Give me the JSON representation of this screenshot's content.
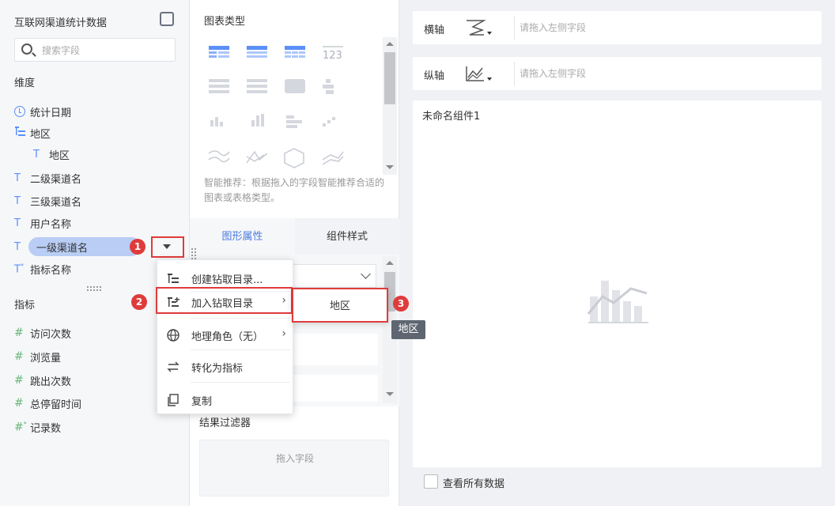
{
  "left": {
    "title": "互联网渠道统计数据",
    "search_placeholder": "搜索字段",
    "dimension_header": "维度",
    "dimensions": [
      {
        "label": "统计日期",
        "icon": "clock-icon"
      },
      {
        "label": "地区",
        "icon": "hierarchy-icon"
      },
      {
        "label": "地区",
        "icon": "text-type-icon",
        "indent": true
      },
      {
        "label": "二级渠道名",
        "icon": "text-type-icon"
      },
      {
        "label": "三级渠道名",
        "icon": "text-type-icon"
      },
      {
        "label": "用户名称",
        "icon": "text-type-icon"
      },
      {
        "label": "一级渠道名",
        "icon": "text-type-icon",
        "selected": true
      },
      {
        "label": "指标名称",
        "icon": "text-type-icon"
      }
    ],
    "measure_header": "指标",
    "measures": [
      {
        "label": "访问次数"
      },
      {
        "label": "浏览量"
      },
      {
        "label": "跳出次数"
      },
      {
        "label": "总停留时间"
      },
      {
        "label": "记录数"
      }
    ],
    "badge_1": "1"
  },
  "middle": {
    "chart_type_title": "图表类型",
    "smart_recommend": "智能推荐：根据拖入的字段智能推荐合适的图表或表格类型。",
    "tabs": [
      "图形属性",
      "组件样式"
    ],
    "filter_title": "结果过滤器",
    "filter_placeholder": "拖入字段"
  },
  "context_menu": {
    "items": [
      {
        "label": "创建钻取目录...",
        "icon": "drill-create-icon"
      },
      {
        "label": "加入钻取目录",
        "icon": "drill-add-icon",
        "has_submenu": true
      },
      {
        "label": "地理角色（无）",
        "icon": "globe-icon",
        "has_submenu": true
      },
      {
        "label": "转化为指标",
        "icon": "swap-icon"
      },
      {
        "label": "复制",
        "icon": "copy-icon"
      }
    ],
    "badge_2": "2",
    "submenu_item": "地区",
    "badge_3": "3",
    "tooltip": "地区"
  },
  "right": {
    "x_axis_label": "横轴",
    "y_axis_label": "纵轴",
    "axis_placeholder": "请拖入左侧字段",
    "widget_title": "未命名组件1",
    "view_all_label": "查看所有数据"
  },
  "colors": {
    "accent": "#4a7be0",
    "highlight": "#e03b3b",
    "selected_field": "#b9cdf5"
  }
}
